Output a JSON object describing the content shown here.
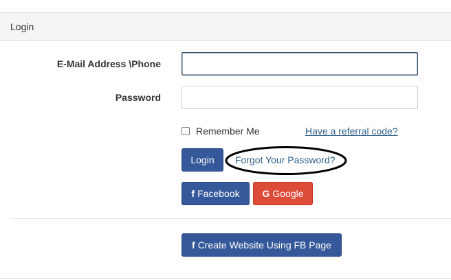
{
  "card": {
    "title": "Login"
  },
  "form": {
    "email_label": "E-Mail Address \\Phone",
    "email_value": "",
    "password_label": "Password",
    "password_value": "",
    "remember_label": "Remember Me",
    "remember_checked": false,
    "referral_link": "Have a referral code?",
    "login_button": "Login",
    "forgot_link": "Forgot Your Password?"
  },
  "social": {
    "facebook_icon": "f",
    "facebook_label": "Facebook",
    "google_icon": "G",
    "google_label": "Google"
  },
  "footer": {
    "create_icon": "f",
    "create_label": "Create Website Using FB Page"
  },
  "colors": {
    "primary": "#34589a",
    "danger": "#dd4b39",
    "link": "#2f5f87",
    "annotation": "#000000"
  }
}
